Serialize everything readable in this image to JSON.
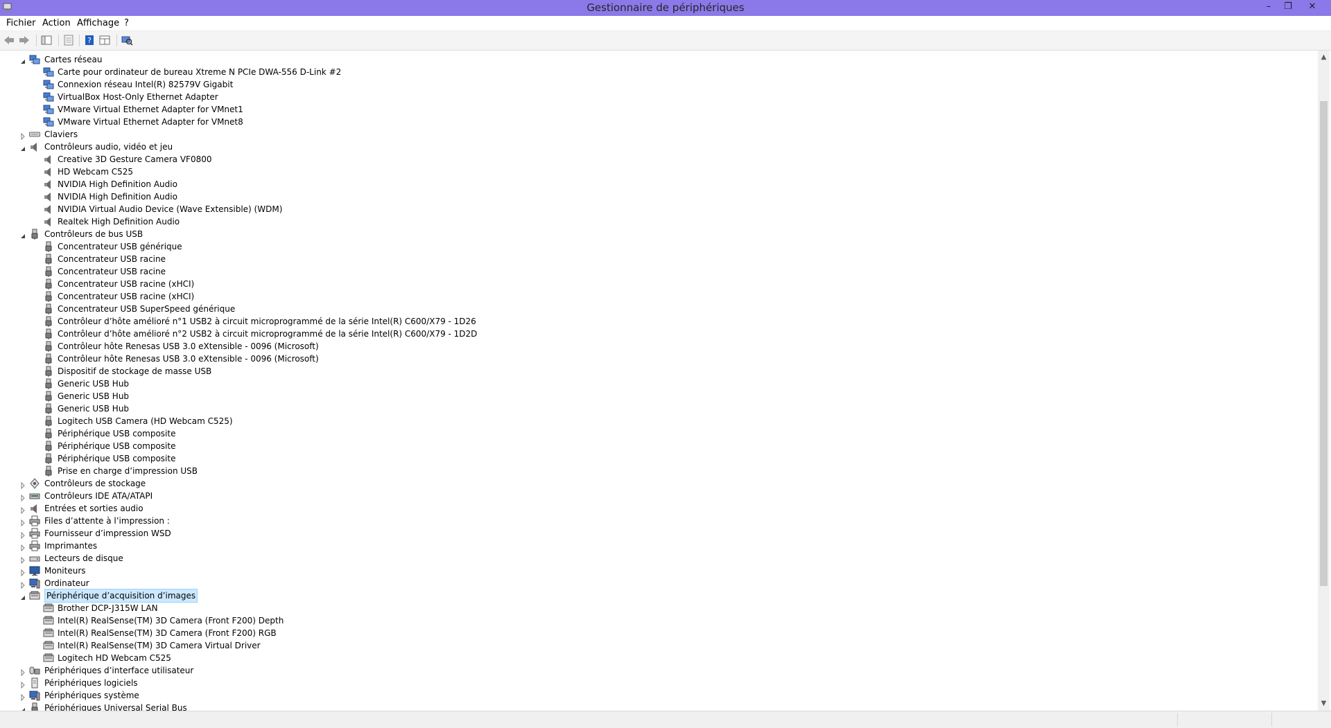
{
  "window": {
    "title": "Gestionnaire de périphériques",
    "controls": {
      "minimize": "–",
      "restore": "❐",
      "close": "✕"
    }
  },
  "menu": [
    {
      "label": "Fichier"
    },
    {
      "label": "Action"
    },
    {
      "label": "Affichage"
    },
    {
      "label": "?"
    }
  ],
  "toolbar": {
    "icons": [
      "back-arrow-icon",
      "forward-arrow-icon",
      "show-hide-console-tree-icon",
      "properties-icon",
      "help-icon",
      "action-pane-icon",
      "scan-hardware-icon"
    ]
  },
  "tree": [
    {
      "label": "Cartes réseau",
      "level": 0,
      "expanded": true,
      "icon": "network"
    },
    {
      "label": "Carte pour ordinateur de bureau Xtreme N PCIe DWA-556 D-Link #2",
      "level": 1,
      "icon": "network"
    },
    {
      "label": "Connexion réseau Intel(R) 82579V Gigabit",
      "level": 1,
      "icon": "network"
    },
    {
      "label": "VirtualBox Host-Only Ethernet Adapter",
      "level": 1,
      "icon": "network"
    },
    {
      "label": "VMware Virtual Ethernet Adapter for VMnet1",
      "level": 1,
      "icon": "network"
    },
    {
      "label": "VMware Virtual Ethernet Adapter for VMnet8",
      "level": 1,
      "icon": "network"
    },
    {
      "label": "Claviers",
      "level": 0,
      "expanded": false,
      "icon": "keyboard"
    },
    {
      "label": "Contrôleurs audio, vidéo et jeu",
      "level": 0,
      "expanded": true,
      "icon": "speaker"
    },
    {
      "label": "Creative 3D Gesture Camera VF0800",
      "level": 1,
      "icon": "speaker"
    },
    {
      "label": "HD Webcam C525",
      "level": 1,
      "icon": "speaker"
    },
    {
      "label": "NVIDIA High Definition Audio",
      "level": 1,
      "icon": "speaker"
    },
    {
      "label": "NVIDIA High Definition Audio",
      "level": 1,
      "icon": "speaker"
    },
    {
      "label": "NVIDIA Virtual Audio Device (Wave Extensible) (WDM)",
      "level": 1,
      "icon": "speaker"
    },
    {
      "label": "Realtek High Definition Audio",
      "level": 1,
      "icon": "speaker"
    },
    {
      "label": "Contrôleurs de bus USB",
      "level": 0,
      "expanded": true,
      "icon": "usb"
    },
    {
      "label": "Concentrateur USB générique",
      "level": 1,
      "icon": "usb"
    },
    {
      "label": "Concentrateur USB racine",
      "level": 1,
      "icon": "usb"
    },
    {
      "label": "Concentrateur USB racine",
      "level": 1,
      "icon": "usb"
    },
    {
      "label": "Concentrateur USB racine (xHCI)",
      "level": 1,
      "icon": "usb"
    },
    {
      "label": "Concentrateur USB racine (xHCI)",
      "level": 1,
      "icon": "usb"
    },
    {
      "label": "Concentrateur USB SuperSpeed générique",
      "level": 1,
      "icon": "usb"
    },
    {
      "label": "Contrôleur d’hôte amélioré n°1 USB2 à circuit microprogrammé de la série Intel(R) C600/X79 - 1D26",
      "level": 1,
      "icon": "usb"
    },
    {
      "label": "Contrôleur d’hôte amélioré n°2 USB2 à circuit microprogrammé de la série Intel(R) C600/X79 - 1D2D",
      "level": 1,
      "icon": "usb"
    },
    {
      "label": "Contrôleur hôte Renesas USB 3.0 eXtensible - 0096 (Microsoft)",
      "level": 1,
      "icon": "usb"
    },
    {
      "label": "Contrôleur hôte Renesas USB 3.0 eXtensible - 0096 (Microsoft)",
      "level": 1,
      "icon": "usb"
    },
    {
      "label": "Dispositif de stockage de masse USB",
      "level": 1,
      "icon": "usb"
    },
    {
      "label": "Generic USB Hub",
      "level": 1,
      "icon": "usb"
    },
    {
      "label": "Generic USB Hub",
      "level": 1,
      "icon": "usb"
    },
    {
      "label": "Generic USB Hub",
      "level": 1,
      "icon": "usb"
    },
    {
      "label": "Logitech USB Camera (HD Webcam C525)",
      "level": 1,
      "icon": "usb"
    },
    {
      "label": "Périphérique USB composite",
      "level": 1,
      "icon": "usb"
    },
    {
      "label": "Périphérique USB composite",
      "level": 1,
      "icon": "usb"
    },
    {
      "label": "Périphérique USB composite",
      "level": 1,
      "icon": "usb"
    },
    {
      "label": "Prise en charge d’impression USB",
      "level": 1,
      "icon": "usb"
    },
    {
      "label": "Contrôleurs de stockage",
      "level": 0,
      "expanded": false,
      "icon": "storage"
    },
    {
      "label": "Contrôleurs IDE ATA/ATAPI",
      "level": 0,
      "expanded": false,
      "icon": "ide"
    },
    {
      "label": "Entrées et sorties audio",
      "level": 0,
      "expanded": false,
      "icon": "speaker"
    },
    {
      "label": "Files d’attente à l’impression :",
      "level": 0,
      "expanded": false,
      "icon": "printer"
    },
    {
      "label": "Fournisseur d’impression WSD",
      "level": 0,
      "expanded": false,
      "icon": "printer"
    },
    {
      "label": "Imprimantes",
      "level": 0,
      "expanded": false,
      "icon": "printer"
    },
    {
      "label": "Lecteurs de disque",
      "level": 0,
      "expanded": false,
      "icon": "disk"
    },
    {
      "label": "Moniteurs",
      "level": 0,
      "expanded": false,
      "icon": "monitor"
    },
    {
      "label": "Ordinateur",
      "level": 0,
      "expanded": false,
      "icon": "computer"
    },
    {
      "label": "Périphérique d’acquisition d’images",
      "level": 0,
      "expanded": true,
      "selected": true,
      "icon": "camera"
    },
    {
      "label": "Brother DCP-J315W LAN",
      "level": 1,
      "icon": "camera"
    },
    {
      "label": "Intel(R) RealSense(TM) 3D Camera (Front F200) Depth",
      "level": 1,
      "icon": "camera"
    },
    {
      "label": "Intel(R) RealSense(TM) 3D Camera (Front F200) RGB",
      "level": 1,
      "icon": "camera"
    },
    {
      "label": "Intel(R) RealSense(TM) 3D Camera Virtual Driver",
      "level": 1,
      "icon": "camera"
    },
    {
      "label": "Logitech HD Webcam C525",
      "level": 1,
      "icon": "camera"
    },
    {
      "label": "Périphériques d’interface utilisateur",
      "level": 0,
      "expanded": false,
      "icon": "hid"
    },
    {
      "label": "Périphériques logiciels",
      "level": 0,
      "expanded": false,
      "icon": "software"
    },
    {
      "label": "Périphériques système",
      "level": 0,
      "expanded": false,
      "icon": "computer"
    },
    {
      "label": "Périphériques Universal Serial Bus",
      "level": 0,
      "expanded": true,
      "icon": "usb"
    }
  ],
  "scrollbar": {
    "position": 0.08,
    "visible_fraction": 0.74
  },
  "colors": {
    "titlebar": "#8b79e9",
    "selection": "#cce8ff",
    "selection_border": "#99d1ff"
  }
}
